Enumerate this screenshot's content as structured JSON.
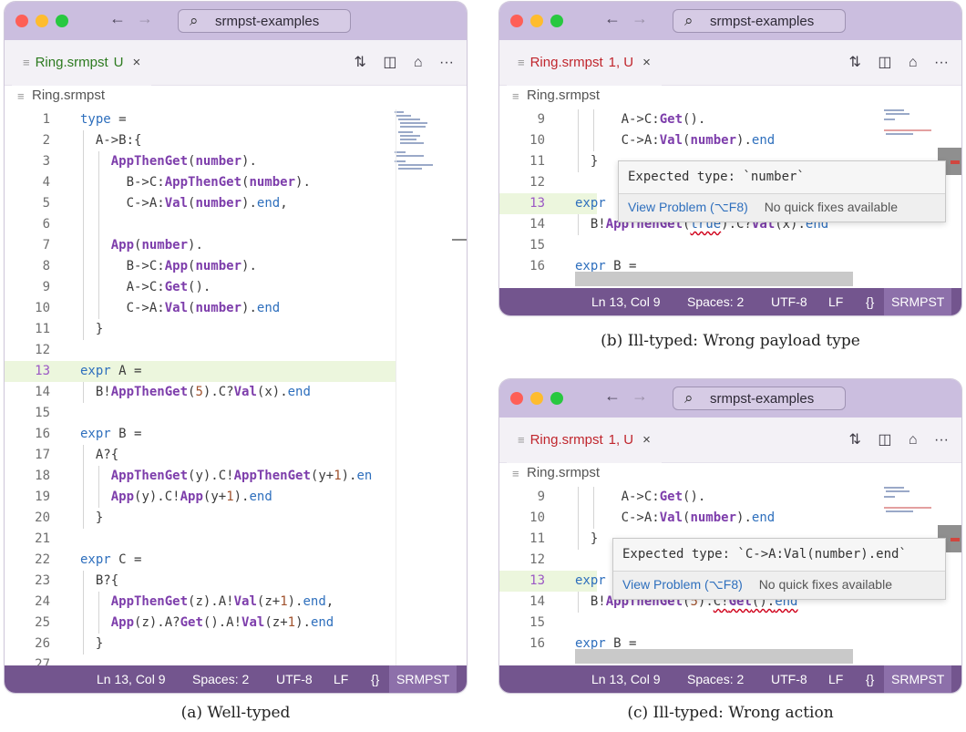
{
  "common": {
    "nav_back": "←",
    "nav_forward": "→",
    "search_label": "srmpst-examples",
    "search_icon": "search-icon",
    "file_name": "Ring.srmpst",
    "close_glyph": "×",
    "action_icons": [
      "source-control-icon",
      "split-editor-icon",
      "lock-icon",
      "more-icon"
    ],
    "action_glyphs": [
      "⇅",
      "◫",
      "⌂",
      "···"
    ]
  },
  "windows": {
    "a": {
      "tab_status": "U",
      "caption": "(a) Well-typed",
      "status": {
        "pos": "Ln 13, Col 9",
        "spaces": "Spaces: 2",
        "enc": "UTF-8",
        "eol": "LF",
        "braces": "{}",
        "lang": "SRMPST"
      },
      "lines": [
        {
          "n": "1",
          "t": "type ="
        },
        {
          "n": "2",
          "t": "  A->B:{"
        },
        {
          "n": "3",
          "t": "    AppThenGet(number)."
        },
        {
          "n": "4",
          "t": "      B->C:AppThenGet(number)."
        },
        {
          "n": "5",
          "t": "      C->A:Val(number).end,"
        },
        {
          "n": "6",
          "t": ""
        },
        {
          "n": "7",
          "t": "    App(number)."
        },
        {
          "n": "8",
          "t": "      B->C:App(number)."
        },
        {
          "n": "9",
          "t": "      A->C:Get()."
        },
        {
          "n": "10",
          "t": "      C->A:Val(number).end"
        },
        {
          "n": "11",
          "t": "  }"
        },
        {
          "n": "12",
          "t": ""
        },
        {
          "n": "13",
          "t": "expr A ="
        },
        {
          "n": "14",
          "t": "  B!AppThenGet(5).C?Val(x).end"
        },
        {
          "n": "15",
          "t": ""
        },
        {
          "n": "16",
          "t": "expr B ="
        },
        {
          "n": "17",
          "t": "  A?{"
        },
        {
          "n": "18",
          "t": "    AppThenGet(y).C!AppThenGet(y+1).en"
        },
        {
          "n": "19",
          "t": "    App(y).C!App(y+1).end"
        },
        {
          "n": "20",
          "t": "  }"
        },
        {
          "n": "21",
          "t": ""
        },
        {
          "n": "22",
          "t": "expr C ="
        },
        {
          "n": "23",
          "t": "  B?{"
        },
        {
          "n": "24",
          "t": "    AppThenGet(z).A!Val(z+1).end,"
        },
        {
          "n": "25",
          "t": "    App(z).A?Get().A!Val(z+1).end"
        },
        {
          "n": "26",
          "t": "  }"
        },
        {
          "n": "27",
          "t": ""
        }
      ]
    },
    "b": {
      "tab_status": "1, U",
      "caption": "(b) Ill-typed: Wrong payload type",
      "status": {
        "pos": "Ln 13, Col 9",
        "spaces": "Spaces: 2",
        "enc": "UTF-8",
        "eol": "LF",
        "braces": "{}",
        "lang": "SRMPST"
      },
      "hover_message": "Expected type: `number`",
      "hover_link": "View Problem (⌥F8)",
      "hover_nofix": "No quick fixes available",
      "lines": [
        {
          "n": "9",
          "t": "      A->C:Get()."
        },
        {
          "n": "10",
          "t": "      C->A:Val(number).end"
        },
        {
          "n": "11",
          "t": "  }"
        },
        {
          "n": "12",
          "t": ""
        },
        {
          "n": "13",
          "t": "expr"
        },
        {
          "n": "14",
          "t": "  B!AppThenGet(true).C?Val(x).end"
        },
        {
          "n": "15",
          "t": ""
        },
        {
          "n": "16",
          "t": "expr B ="
        }
      ]
    },
    "c": {
      "tab_status": "1, U",
      "caption": "(c) Ill-typed: Wrong action",
      "status": {
        "pos": "Ln 13, Col 9",
        "spaces": "Spaces: 2",
        "enc": "UTF-8",
        "eol": "LF",
        "braces": "{}",
        "lang": "SRMPST"
      },
      "hover_message": "Expected type: `C->A:Val(number).end`",
      "hover_link": "View Problem (⌥F8)",
      "hover_nofix": "No quick fixes available",
      "lines": [
        {
          "n": "9",
          "t": "      A->C:Get()."
        },
        {
          "n": "10",
          "t": "      C->A:Val(number).end"
        },
        {
          "n": "11",
          "t": "  }"
        },
        {
          "n": "12",
          "t": ""
        },
        {
          "n": "13",
          "t": "expr"
        },
        {
          "n": "14",
          "t": "  B!AppThenGet(5).C!Get().end"
        },
        {
          "n": "15",
          "t": ""
        },
        {
          "n": "16",
          "t": "expr B ="
        }
      ]
    }
  },
  "colors": {
    "titlebar": "#cbbedf",
    "statusbar": "#73558e",
    "active_line": "#ecf6dd",
    "keyword": "#2e6fbd",
    "constructor": "#7d3dab",
    "error": "#c0262d"
  }
}
